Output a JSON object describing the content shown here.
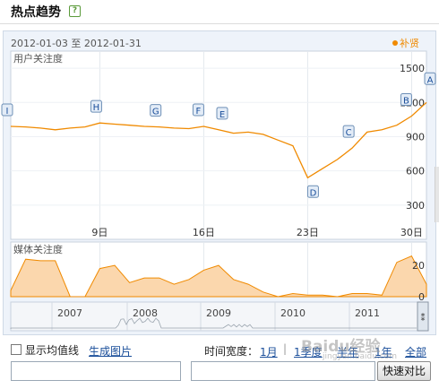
{
  "header": {
    "title": "热点趋势",
    "help_icon": "?"
  },
  "date_range": "2012-01-03 至 2012-01-31",
  "legend": {
    "label": "补贤",
    "color": "#f08a00"
  },
  "user_chart": {
    "label": "用户关注度",
    "y_ticks": [
      "1500",
      "1200",
      "900",
      "600",
      "300"
    ],
    "x_ticks": [
      "9日",
      "16日",
      "23日",
      "30日"
    ]
  },
  "media_chart": {
    "label": "媒体关注度",
    "y_ticks": [
      "20",
      "0"
    ]
  },
  "overview": {
    "years": [
      "2007",
      "2008",
      "2009",
      "2010",
      "2011"
    ]
  },
  "footer": {
    "show_avg_label": "显示均值线",
    "gen_image_label": "生成图片",
    "time_width_label": "时间宽度：",
    "ranges": [
      "1月",
      "1季度",
      "半年",
      "1年",
      "全部"
    ],
    "compare_button": "快速对比",
    "watermark": "Baidu经验",
    "watermark_sub": "jingyan.baidu.com"
  },
  "chart_data": [
    {
      "type": "line",
      "title": "用户关注度",
      "x": [
        "2012-01-03",
        "2012-01-04",
        "2012-01-05",
        "2012-01-06",
        "2012-01-07",
        "2012-01-08",
        "2012-01-09",
        "2012-01-10",
        "2012-01-11",
        "2012-01-12",
        "2012-01-13",
        "2012-01-14",
        "2012-01-15",
        "2012-01-16",
        "2012-01-17",
        "2012-01-18",
        "2012-01-19",
        "2012-01-20",
        "2012-01-21",
        "2012-01-22",
        "2012-01-23",
        "2012-01-24",
        "2012-01-25",
        "2012-01-26",
        "2012-01-27",
        "2012-01-28",
        "2012-01-29",
        "2012-01-30",
        "2012-01-31"
      ],
      "series": [
        {
          "name": "补贤",
          "values": [
            990,
            985,
            975,
            960,
            975,
            985,
            1020,
            1010,
            1000,
            990,
            985,
            975,
            970,
            990,
            960,
            930,
            940,
            920,
            870,
            820,
            540,
            620,
            700,
            800,
            940,
            960,
            1000,
            1080,
            1200
          ]
        }
      ],
      "ylim": [
        0,
        1650
      ],
      "y_ticks": [
        300,
        600,
        900,
        1200,
        1500
      ],
      "annotations": [
        {
          "label": "I",
          "x": "2012-01-03"
        },
        {
          "label": "H",
          "x": "2012-01-09"
        },
        {
          "label": "G",
          "x": "2012-01-13"
        },
        {
          "label": "F",
          "x": "2012-01-16"
        },
        {
          "label": "E",
          "x": "2012-01-17"
        },
        {
          "label": "D",
          "x": "2012-01-23"
        },
        {
          "label": "C",
          "x": "2012-01-26"
        },
        {
          "label": "B",
          "x": "2012-01-30"
        },
        {
          "label": "A",
          "x": "2012-01-31"
        }
      ]
    },
    {
      "type": "area",
      "title": "媒体关注度",
      "x": [
        "2012-01-03",
        "2012-01-04",
        "2012-01-05",
        "2012-01-06",
        "2012-01-07",
        "2012-01-08",
        "2012-01-09",
        "2012-01-10",
        "2012-01-11",
        "2012-01-12",
        "2012-01-13",
        "2012-01-14",
        "2012-01-15",
        "2012-01-16",
        "2012-01-17",
        "2012-01-18",
        "2012-01-19",
        "2012-01-20",
        "2012-01-21",
        "2012-01-22",
        "2012-01-23",
        "2012-01-24",
        "2012-01-25",
        "2012-01-26",
        "2012-01-27",
        "2012-01-28",
        "2012-01-29",
        "2012-01-30",
        "2012-01-31"
      ],
      "series": [
        {
          "name": "补贤",
          "values": [
            4,
            24,
            23,
            23,
            0,
            0,
            18,
            20,
            9,
            12,
            12,
            8,
            11,
            17,
            20,
            11,
            8,
            3,
            0,
            2,
            1,
            1,
            0,
            2,
            2,
            1,
            22,
            26,
            8
          ]
        }
      ],
      "ylim": [
        0,
        35
      ],
      "y_ticks": [
        0,
        20
      ]
    }
  ]
}
